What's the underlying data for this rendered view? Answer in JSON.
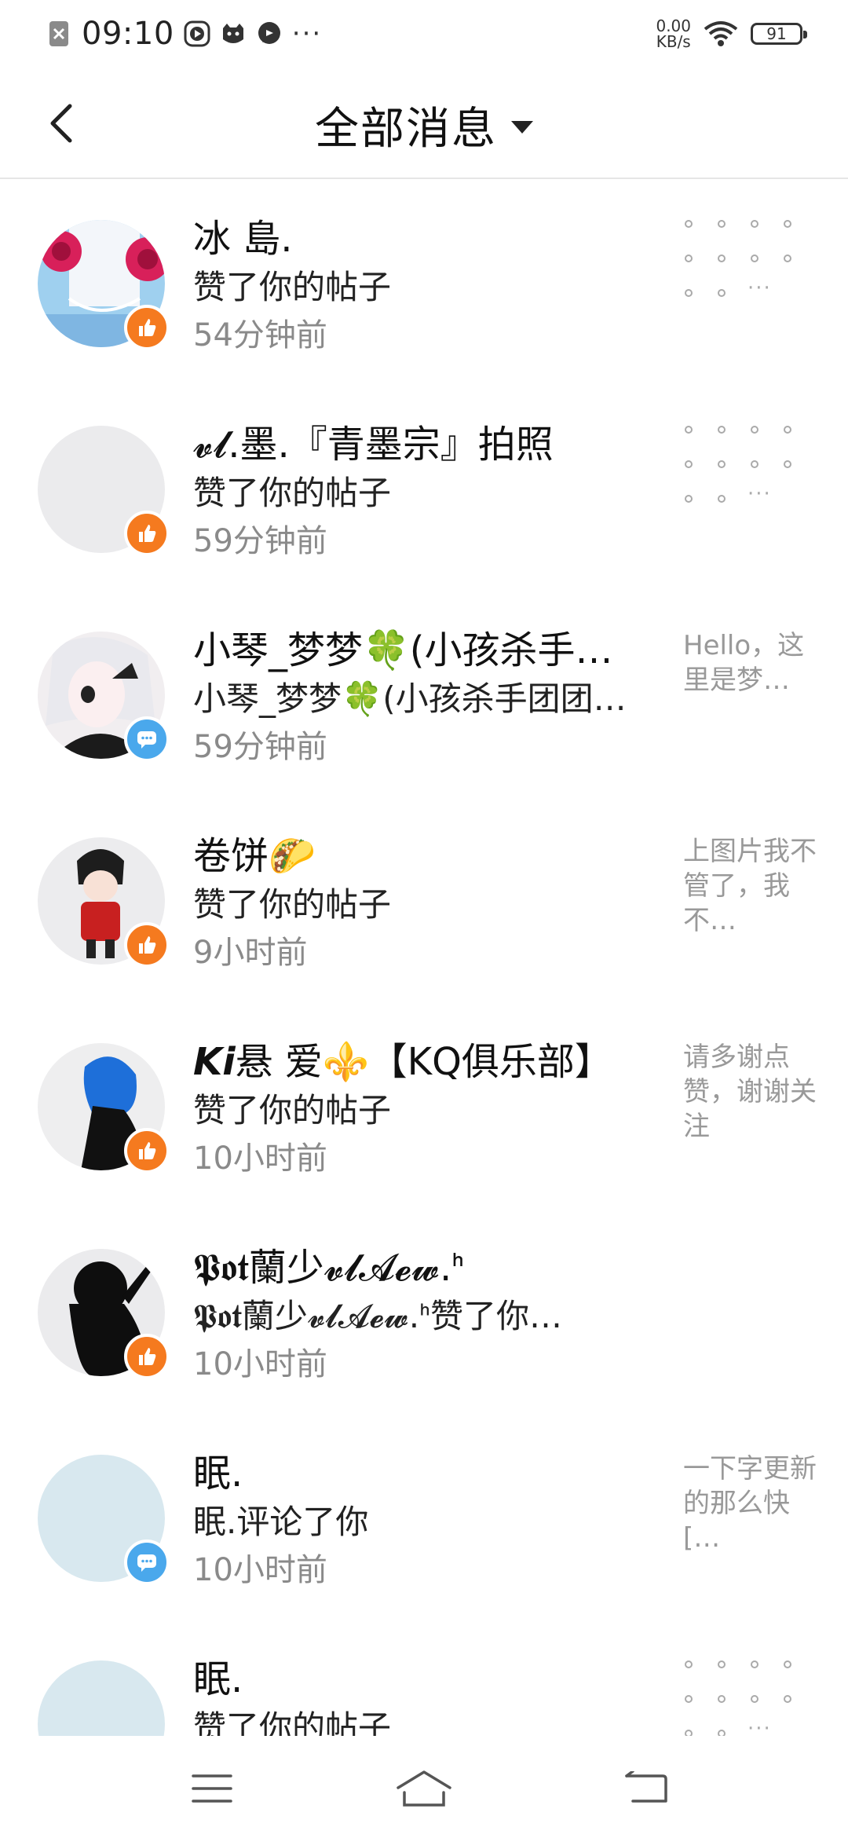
{
  "status_bar": {
    "time": "09:10",
    "more": "···",
    "speed_value": "0.00",
    "speed_unit": "KB/s",
    "battery": "91",
    "icons": [
      "close-notification-icon",
      "play-icon",
      "cat-icon",
      "chat-bubble-icon",
      "wifi-icon",
      "battery-icon"
    ]
  },
  "header": {
    "title": "全部消息",
    "back_icon": "chevron-left-icon",
    "dropdown_icon": "caret-down-icon"
  },
  "messages": [
    {
      "name": "冰 島.",
      "action": "赞了你的帖子",
      "time": "54分钟前",
      "badge": "like",
      "preview": "",
      "avatar": "anime-roses",
      "has_thumbnail_dots": true
    },
    {
      "name": "𝓿𝓵.墨.『青墨宗』拍照",
      "action": "赞了你的帖子",
      "time": "59分钟前",
      "badge": "like",
      "preview": "",
      "avatar": "blank-gray",
      "has_thumbnail_dots": true
    },
    {
      "name": "小琴_梦梦🍀(小孩杀手…",
      "action": "小琴_梦梦🍀(小孩杀手团团…",
      "time": "59分钟前",
      "badge": "comment",
      "preview": "Hello，这里是梦…",
      "avatar": "anime-white-hair",
      "has_thumbnail_dots": false
    },
    {
      "name": "卷饼🌮",
      "action": "赞了你的帖子",
      "time": "9小时前",
      "badge": "like",
      "preview": "上图片我不管了，我不…",
      "avatar": "anime-red-jacket",
      "has_thumbnail_dots": false
    },
    {
      "name": "𝙆𝙞悬 爱⚜️【KQ俱乐部】",
      "action": "赞了你的帖子",
      "time": "10小时前",
      "badge": "like",
      "preview": "请多谢点赞，谢谢关注",
      "avatar": "anime-blue-hair",
      "has_thumbnail_dots": false
    },
    {
      "name": "𝕻𝖔𝖙蘭少𝓿𝓵𝓐𝓮𝔀.ᑋ",
      "action": "𝕻𝖔𝖙蘭少𝓿𝓵𝓐𝓮𝔀.ᑋ赞了你…",
      "time": "10小时前",
      "badge": "like",
      "preview": "",
      "avatar": "silhouette",
      "has_thumbnail_dots": false
    },
    {
      "name": "眠.",
      "action": "眠.评论了你",
      "time": "10小时前",
      "badge": "comment",
      "preview": "一下字更新的那么快[…",
      "avatar": "blank-light-blue",
      "has_thumbnail_dots": false
    },
    {
      "name": "眠.",
      "action": "赞了你的帖子",
      "time": "",
      "badge": "none",
      "preview": "",
      "avatar": "blank-light-blue",
      "has_thumbnail_dots": true
    }
  ],
  "navbar": {
    "icons": [
      "menu-icon",
      "home-icon",
      "back-icon"
    ]
  },
  "colors": {
    "like_badge": "#f57a1f",
    "comment_badge": "#4aa8ec",
    "secondary_text": "#8a8a8a",
    "preview_text": "#999999"
  }
}
